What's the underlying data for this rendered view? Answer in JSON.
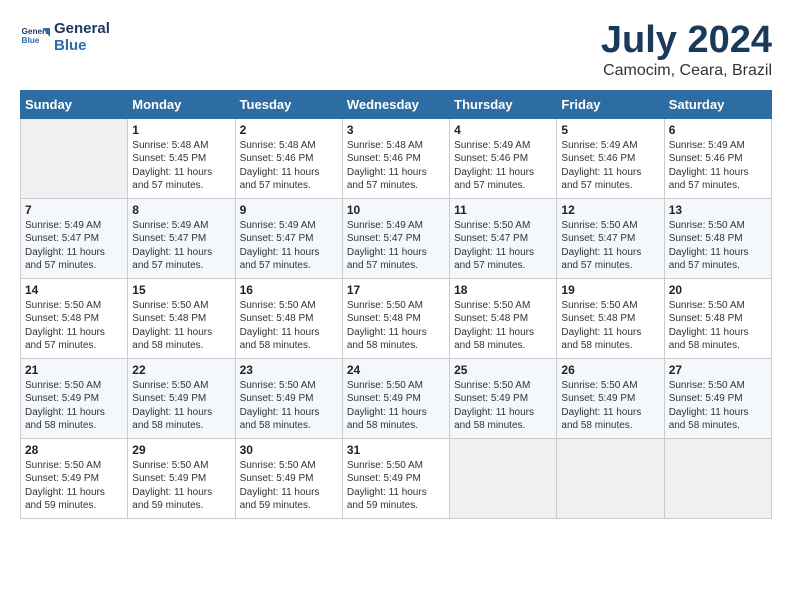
{
  "header": {
    "logo_line1": "General",
    "logo_line2": "Blue",
    "title": "July 2024",
    "subtitle": "Camocim, Ceara, Brazil"
  },
  "weekdays": [
    "Sunday",
    "Monday",
    "Tuesday",
    "Wednesday",
    "Thursday",
    "Friday",
    "Saturday"
  ],
  "weeks": [
    [
      {
        "day": "",
        "info": ""
      },
      {
        "day": "1",
        "info": "Sunrise: 5:48 AM\nSunset: 5:45 PM\nDaylight: 11 hours\nand 57 minutes."
      },
      {
        "day": "2",
        "info": "Sunrise: 5:48 AM\nSunset: 5:46 PM\nDaylight: 11 hours\nand 57 minutes."
      },
      {
        "day": "3",
        "info": "Sunrise: 5:48 AM\nSunset: 5:46 PM\nDaylight: 11 hours\nand 57 minutes."
      },
      {
        "day": "4",
        "info": "Sunrise: 5:49 AM\nSunset: 5:46 PM\nDaylight: 11 hours\nand 57 minutes."
      },
      {
        "day": "5",
        "info": "Sunrise: 5:49 AM\nSunset: 5:46 PM\nDaylight: 11 hours\nand 57 minutes."
      },
      {
        "day": "6",
        "info": "Sunrise: 5:49 AM\nSunset: 5:46 PM\nDaylight: 11 hours\nand 57 minutes."
      }
    ],
    [
      {
        "day": "7",
        "info": "Sunrise: 5:49 AM\nSunset: 5:47 PM\nDaylight: 11 hours\nand 57 minutes."
      },
      {
        "day": "8",
        "info": "Sunrise: 5:49 AM\nSunset: 5:47 PM\nDaylight: 11 hours\nand 57 minutes."
      },
      {
        "day": "9",
        "info": "Sunrise: 5:49 AM\nSunset: 5:47 PM\nDaylight: 11 hours\nand 57 minutes."
      },
      {
        "day": "10",
        "info": "Sunrise: 5:49 AM\nSunset: 5:47 PM\nDaylight: 11 hours\nand 57 minutes."
      },
      {
        "day": "11",
        "info": "Sunrise: 5:50 AM\nSunset: 5:47 PM\nDaylight: 11 hours\nand 57 minutes."
      },
      {
        "day": "12",
        "info": "Sunrise: 5:50 AM\nSunset: 5:47 PM\nDaylight: 11 hours\nand 57 minutes."
      },
      {
        "day": "13",
        "info": "Sunrise: 5:50 AM\nSunset: 5:48 PM\nDaylight: 11 hours\nand 57 minutes."
      }
    ],
    [
      {
        "day": "14",
        "info": "Sunrise: 5:50 AM\nSunset: 5:48 PM\nDaylight: 11 hours\nand 57 minutes."
      },
      {
        "day": "15",
        "info": "Sunrise: 5:50 AM\nSunset: 5:48 PM\nDaylight: 11 hours\nand 58 minutes."
      },
      {
        "day": "16",
        "info": "Sunrise: 5:50 AM\nSunset: 5:48 PM\nDaylight: 11 hours\nand 58 minutes."
      },
      {
        "day": "17",
        "info": "Sunrise: 5:50 AM\nSunset: 5:48 PM\nDaylight: 11 hours\nand 58 minutes."
      },
      {
        "day": "18",
        "info": "Sunrise: 5:50 AM\nSunset: 5:48 PM\nDaylight: 11 hours\nand 58 minutes."
      },
      {
        "day": "19",
        "info": "Sunrise: 5:50 AM\nSunset: 5:48 PM\nDaylight: 11 hours\nand 58 minutes."
      },
      {
        "day": "20",
        "info": "Sunrise: 5:50 AM\nSunset: 5:48 PM\nDaylight: 11 hours\nand 58 minutes."
      }
    ],
    [
      {
        "day": "21",
        "info": "Sunrise: 5:50 AM\nSunset: 5:49 PM\nDaylight: 11 hours\nand 58 minutes."
      },
      {
        "day": "22",
        "info": "Sunrise: 5:50 AM\nSunset: 5:49 PM\nDaylight: 11 hours\nand 58 minutes."
      },
      {
        "day": "23",
        "info": "Sunrise: 5:50 AM\nSunset: 5:49 PM\nDaylight: 11 hours\nand 58 minutes."
      },
      {
        "day": "24",
        "info": "Sunrise: 5:50 AM\nSunset: 5:49 PM\nDaylight: 11 hours\nand 58 minutes."
      },
      {
        "day": "25",
        "info": "Sunrise: 5:50 AM\nSunset: 5:49 PM\nDaylight: 11 hours\nand 58 minutes."
      },
      {
        "day": "26",
        "info": "Sunrise: 5:50 AM\nSunset: 5:49 PM\nDaylight: 11 hours\nand 58 minutes."
      },
      {
        "day": "27",
        "info": "Sunrise: 5:50 AM\nSunset: 5:49 PM\nDaylight: 11 hours\nand 58 minutes."
      }
    ],
    [
      {
        "day": "28",
        "info": "Sunrise: 5:50 AM\nSunset: 5:49 PM\nDaylight: 11 hours\nand 59 minutes."
      },
      {
        "day": "29",
        "info": "Sunrise: 5:50 AM\nSunset: 5:49 PM\nDaylight: 11 hours\nand 59 minutes."
      },
      {
        "day": "30",
        "info": "Sunrise: 5:50 AM\nSunset: 5:49 PM\nDaylight: 11 hours\nand 59 minutes."
      },
      {
        "day": "31",
        "info": "Sunrise: 5:50 AM\nSunset: 5:49 PM\nDaylight: 11 hours\nand 59 minutes."
      },
      {
        "day": "",
        "info": ""
      },
      {
        "day": "",
        "info": ""
      },
      {
        "day": "",
        "info": ""
      }
    ]
  ]
}
